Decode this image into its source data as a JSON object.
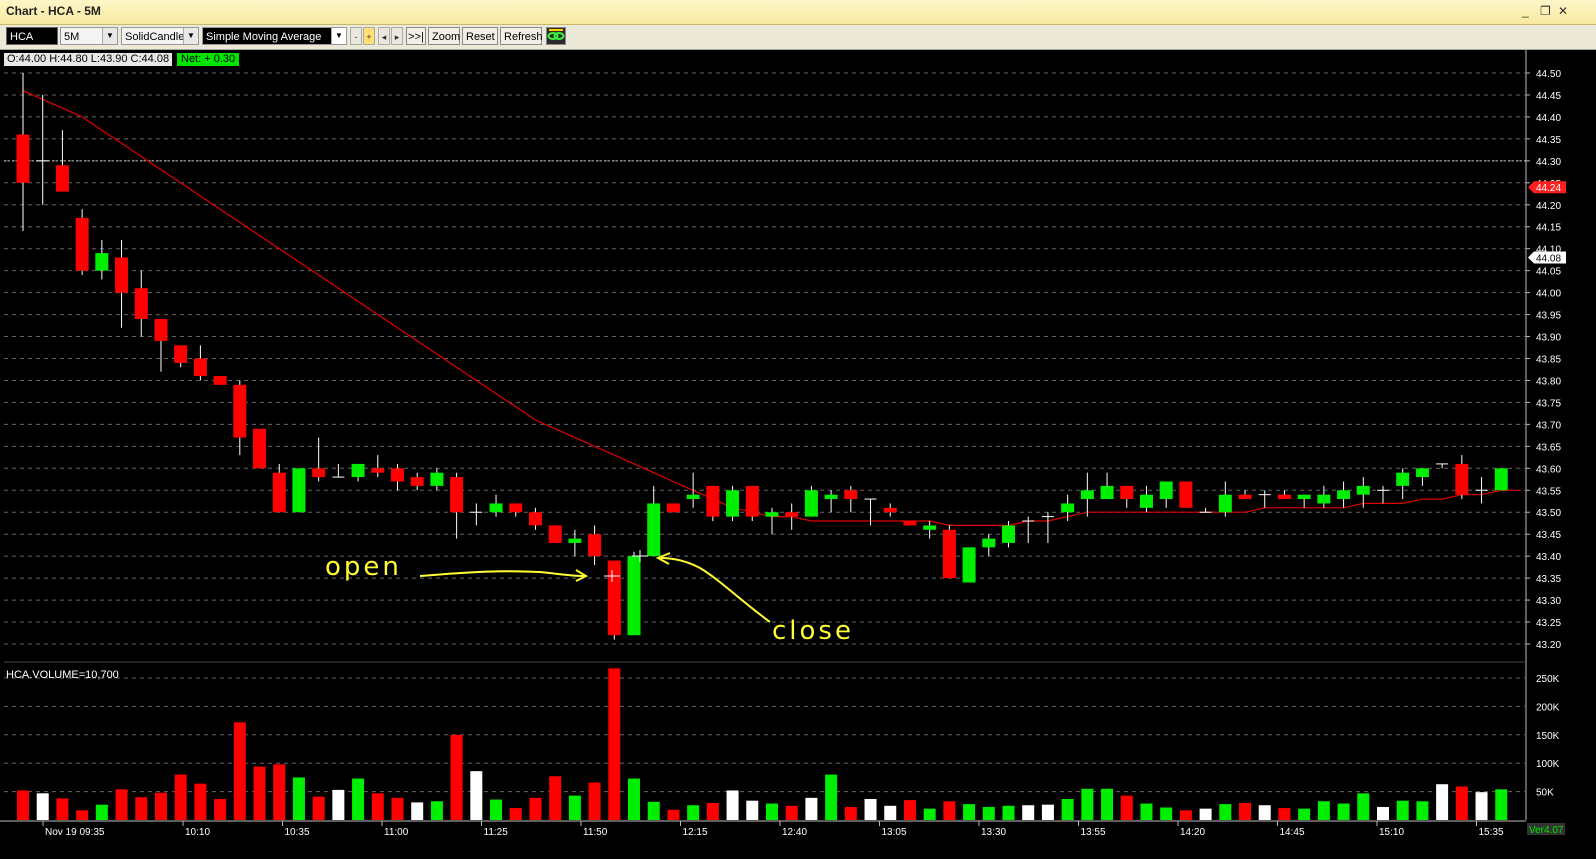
{
  "window": {
    "title": "Chart - HCA - 5M",
    "buttons": [
      "_",
      "❐",
      "✕"
    ]
  },
  "toolbar": {
    "symbol": "HCA",
    "interval": "5M",
    "chart_type": "SolidCandle",
    "indicator": "Simple Moving Average",
    "minus": "-",
    "plus": "+",
    "prev": "◂",
    "next": "▸",
    "end": ">>|",
    "zoom": "Zoom",
    "reset": "Reset",
    "refresh": "Refresh",
    "link_icon": "link-icon"
  },
  "ohlc": {
    "text": "O:44.00  H:44.80  L:43.90  C:44.08",
    "net": "Net: + 0.30"
  },
  "volume_label": "HCA.VOLUME=10,700",
  "version": "Ver4.07",
  "annotations": {
    "open": "open",
    "close": "close"
  },
  "colors": {
    "up": "#00ee00",
    "down": "#ff0000",
    "neutral": "#ffffff",
    "sma": "#e00000",
    "annotation": "#ffff33",
    "last_price_tag": "#ff2020",
    "price_tag": "#ffffff"
  },
  "chart_data": {
    "type": "candlestick",
    "price_axis": {
      "min": 43.2,
      "max": 44.5,
      "ticks": [
        "44.50",
        "44.45",
        "44.40",
        "44.35",
        "44.30",
        "44.25",
        "44.20",
        "44.15",
        "44.10",
        "44.05",
        "44.00",
        "43.95",
        "43.90",
        "43.85",
        "43.80",
        "43.75",
        "43.70",
        "43.65",
        "43.60",
        "43.55",
        "43.50",
        "43.45",
        "43.40",
        "43.35",
        "43.30",
        "43.25",
        "43.20"
      ]
    },
    "volume_axis": {
      "max": 250000,
      "ticks": [
        "250K",
        "200K",
        "150K",
        "100K",
        "50K"
      ]
    },
    "price_tags": [
      {
        "label": "44.24",
        "value": 44.24,
        "style": "red"
      },
      {
        "label": "44.08",
        "value": 44.08,
        "style": "white"
      }
    ],
    "x_ticks": [
      "Nov 19 09:35",
      "10:10",
      "10:35",
      "11:00",
      "11:25",
      "11:50",
      "12:15",
      "12:40",
      "13:05",
      "13:30",
      "13:55",
      "14:20",
      "14:45",
      "15:10",
      "15:35"
    ],
    "candles": [
      {
        "o": 44.36,
        "h": 44.5,
        "l": 44.14,
        "c": 44.25,
        "v": 52000
      },
      {
        "o": 44.3,
        "h": 44.45,
        "l": 44.2,
        "c": 44.3,
        "v": 47000
      },
      {
        "o": 44.29,
        "h": 44.37,
        "l": 44.23,
        "c": 44.23,
        "v": 38000
      },
      {
        "o": 44.17,
        "h": 44.19,
        "l": 44.04,
        "c": 44.05,
        "v": 17000
      },
      {
        "o": 44.05,
        "h": 44.12,
        "l": 44.03,
        "c": 44.09,
        "v": 27000
      },
      {
        "o": 44.08,
        "h": 44.12,
        "l": 43.92,
        "c": 44.0,
        "v": 54000
      },
      {
        "o": 44.01,
        "h": 44.05,
        "l": 43.9,
        "c": 43.94,
        "v": 40000
      },
      {
        "o": 43.94,
        "h": 43.94,
        "l": 43.82,
        "c": 43.89,
        "v": 48000
      },
      {
        "o": 43.88,
        "h": 43.88,
        "l": 43.83,
        "c": 43.84,
        "v": 80000
      },
      {
        "o": 43.85,
        "h": 43.88,
        "l": 43.8,
        "c": 43.81,
        "v": 64000
      },
      {
        "o": 43.81,
        "h": 43.81,
        "l": 43.79,
        "c": 43.79,
        "v": 37000
      },
      {
        "o": 43.79,
        "h": 43.8,
        "l": 43.63,
        "c": 43.67,
        "v": 172000
      },
      {
        "o": 43.69,
        "h": 43.69,
        "l": 43.6,
        "c": 43.6,
        "v": 94000
      },
      {
        "o": 43.59,
        "h": 43.61,
        "l": 43.5,
        "c": 43.5,
        "v": 98000
      },
      {
        "o": 43.5,
        "h": 43.6,
        "l": 43.5,
        "c": 43.6,
        "v": 75000
      },
      {
        "o": 43.6,
        "h": 43.67,
        "l": 43.57,
        "c": 43.58,
        "v": 41000
      },
      {
        "o": 43.58,
        "h": 43.61,
        "l": 43.58,
        "c": 43.58,
        "v": 53000
      },
      {
        "o": 43.58,
        "h": 43.61,
        "l": 43.57,
        "c": 43.61,
        "v": 73000
      },
      {
        "o": 43.6,
        "h": 43.63,
        "l": 43.58,
        "c": 43.59,
        "v": 47000
      },
      {
        "o": 43.6,
        "h": 43.61,
        "l": 43.55,
        "c": 43.57,
        "v": 39000
      },
      {
        "o": 43.58,
        "h": 43.59,
        "l": 43.55,
        "c": 43.56,
        "v": 31000
      },
      {
        "o": 43.56,
        "h": 43.6,
        "l": 43.55,
        "c": 43.59,
        "v": 33000
      },
      {
        "o": 43.58,
        "h": 43.59,
        "l": 43.44,
        "c": 43.5,
        "v": 150000
      },
      {
        "o": 43.5,
        "h": 43.52,
        "l": 43.47,
        "c": 43.5,
        "v": 86000
      },
      {
        "o": 43.5,
        "h": 43.54,
        "l": 43.49,
        "c": 43.52,
        "v": 36000
      },
      {
        "o": 43.52,
        "h": 43.52,
        "l": 43.49,
        "c": 43.5,
        "v": 21000
      },
      {
        "o": 43.5,
        "h": 43.51,
        "l": 43.46,
        "c": 43.47,
        "v": 39000
      },
      {
        "o": 43.47,
        "h": 43.47,
        "l": 43.43,
        "c": 43.43,
        "v": 77000
      },
      {
        "o": 43.43,
        "h": 43.46,
        "l": 43.4,
        "c": 43.44,
        "v": 43000
      },
      {
        "o": 43.45,
        "h": 43.47,
        "l": 43.38,
        "c": 43.4,
        "v": 66000
      },
      {
        "o": 43.39,
        "h": 43.39,
        "l": 43.21,
        "c": 43.22,
        "v": 267000
      },
      {
        "o": 43.22,
        "h": 43.41,
        "l": 43.22,
        "c": 43.4,
        "v": 73000
      },
      {
        "o": 43.4,
        "h": 43.56,
        "l": 43.4,
        "c": 43.52,
        "v": 32000
      },
      {
        "o": 43.52,
        "h": 43.52,
        "l": 43.5,
        "c": 43.5,
        "v": 18000
      },
      {
        "o": 43.53,
        "h": 43.59,
        "l": 43.51,
        "c": 43.54,
        "v": 26000
      },
      {
        "o": 43.56,
        "h": 43.56,
        "l": 43.48,
        "c": 43.49,
        "v": 30000
      },
      {
        "o": 43.49,
        "h": 43.56,
        "l": 43.48,
        "c": 43.55,
        "v": 52000
      },
      {
        "o": 43.56,
        "h": 43.56,
        "l": 43.48,
        "c": 43.49,
        "v": 34000
      },
      {
        "o": 43.49,
        "h": 43.51,
        "l": 43.45,
        "c": 43.5,
        "v": 29000
      },
      {
        "o": 43.5,
        "h": 43.52,
        "l": 43.46,
        "c": 43.49,
        "v": 25000
      },
      {
        "o": 43.49,
        "h": 43.56,
        "l": 43.49,
        "c": 43.55,
        "v": 39000
      },
      {
        "o": 43.53,
        "h": 43.55,
        "l": 43.5,
        "c": 43.54,
        "v": 80000
      },
      {
        "o": 43.55,
        "h": 43.56,
        "l": 43.5,
        "c": 43.53,
        "v": 23000
      },
      {
        "o": 43.53,
        "h": 43.53,
        "l": 43.47,
        "c": 43.53,
        "v": 37000
      },
      {
        "o": 43.51,
        "h": 43.52,
        "l": 43.49,
        "c": 43.5,
        "v": 25000
      },
      {
        "o": 43.48,
        "h": 43.48,
        "l": 43.47,
        "c": 43.47,
        "v": 35000
      },
      {
        "o": 43.46,
        "h": 43.48,
        "l": 43.44,
        "c": 43.47,
        "v": 20000
      },
      {
        "o": 43.46,
        "h": 43.47,
        "l": 43.35,
        "c": 43.35,
        "v": 33000
      },
      {
        "o": 43.34,
        "h": 43.42,
        "l": 43.34,
        "c": 43.42,
        "v": 28000
      },
      {
        "o": 43.42,
        "h": 43.45,
        "l": 43.4,
        "c": 43.44,
        "v": 23000
      },
      {
        "o": 43.43,
        "h": 43.48,
        "l": 43.42,
        "c": 43.47,
        "v": 25000
      },
      {
        "o": 43.48,
        "h": 43.49,
        "l": 43.43,
        "c": 43.48,
        "v": 26000
      },
      {
        "o": 43.49,
        "h": 43.5,
        "l": 43.43,
        "c": 43.49,
        "v": 27000
      },
      {
        "o": 43.5,
        "h": 43.54,
        "l": 43.48,
        "c": 43.52,
        "v": 37000
      },
      {
        "o": 43.53,
        "h": 43.59,
        "l": 43.49,
        "c": 43.55,
        "v": 55000
      },
      {
        "o": 43.53,
        "h": 43.59,
        "l": 43.53,
        "c": 43.56,
        "v": 55000
      },
      {
        "o": 43.56,
        "h": 43.56,
        "l": 43.51,
        "c": 43.53,
        "v": 43000
      },
      {
        "o": 43.51,
        "h": 43.56,
        "l": 43.5,
        "c": 43.54,
        "v": 29000
      },
      {
        "o": 43.53,
        "h": 43.57,
        "l": 43.51,
        "c": 43.57,
        "v": 22000
      },
      {
        "o": 43.57,
        "h": 43.57,
        "l": 43.51,
        "c": 43.51,
        "v": 17000
      },
      {
        "o": 43.5,
        "h": 43.51,
        "l": 43.5,
        "c": 43.5,
        "v": 20000
      },
      {
        "o": 43.5,
        "h": 43.57,
        "l": 43.49,
        "c": 43.54,
        "v": 28000
      },
      {
        "o": 43.54,
        "h": 43.55,
        "l": 43.53,
        "c": 43.53,
        "v": 30000
      },
      {
        "o": 43.54,
        "h": 43.55,
        "l": 43.51,
        "c": 43.54,
        "v": 26000
      },
      {
        "o": 43.54,
        "h": 43.55,
        "l": 43.53,
        "c": 43.53,
        "v": 21000
      },
      {
        "o": 43.53,
        "h": 43.54,
        "l": 43.51,
        "c": 43.54,
        "v": 20000
      },
      {
        "o": 43.52,
        "h": 43.56,
        "l": 43.51,
        "c": 43.54,
        "v": 33000
      },
      {
        "o": 43.53,
        "h": 43.57,
        "l": 43.51,
        "c": 43.55,
        "v": 29000
      },
      {
        "o": 43.54,
        "h": 43.58,
        "l": 43.51,
        "c": 43.56,
        "v": 47000
      },
      {
        "o": 43.55,
        "h": 43.56,
        "l": 43.52,
        "c": 43.55,
        "v": 23000
      },
      {
        "o": 43.56,
        "h": 43.6,
        "l": 43.53,
        "c": 43.59,
        "v": 34000
      },
      {
        "o": 43.58,
        "h": 43.6,
        "l": 43.56,
        "c": 43.6,
        "v": 33000
      },
      {
        "o": 43.61,
        "h": 43.61,
        "l": 43.6,
        "c": 43.61,
        "v": 63000
      },
      {
        "o": 43.61,
        "h": 43.63,
        "l": 43.53,
        "c": 43.54,
        "v": 59000
      },
      {
        "o": 43.55,
        "h": 43.58,
        "l": 43.52,
        "c": 43.55,
        "v": 49000
      },
      {
        "o": 43.55,
        "h": 43.6,
        "l": 43.55,
        "c": 43.6,
        "v": 54000
      }
    ],
    "sma": [
      44.46,
      44.44,
      44.42,
      44.4,
      44.37,
      44.34,
      44.31,
      44.28,
      44.25,
      44.22,
      44.19,
      44.16,
      44.13,
      44.1,
      44.07,
      44.04,
      44.01,
      43.98,
      43.95,
      43.92,
      43.89,
      43.86,
      43.83,
      43.8,
      43.77,
      43.74,
      43.71,
      43.69,
      43.67,
      43.65,
      43.63,
      43.61,
      43.59,
      43.57,
      43.55,
      43.53,
      43.51,
      43.5,
      43.49,
      43.49,
      43.48,
      43.48,
      43.48,
      43.48,
      43.48,
      43.48,
      43.48,
      43.47,
      43.47,
      43.47,
      43.47,
      43.48,
      43.48,
      43.49,
      43.5,
      43.5,
      43.5,
      43.5,
      43.5,
      43.5,
      43.5,
      43.5,
      43.5,
      43.51,
      43.51,
      43.51,
      43.51,
      43.51,
      43.52,
      43.52,
      43.52,
      43.53,
      43.53,
      43.54,
      43.54,
      43.55,
      43.55
    ],
    "grid": true
  }
}
